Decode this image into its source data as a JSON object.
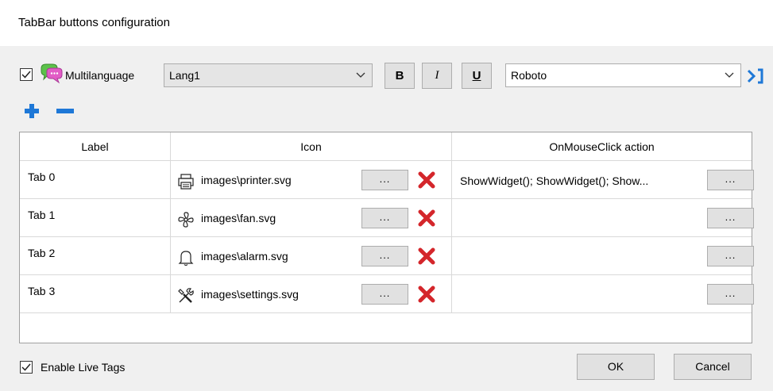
{
  "window": {
    "title": "TabBar buttons configuration"
  },
  "toolbar": {
    "multilanguage_label": "Multilanguage",
    "multilanguage_checked": true,
    "language": "Lang1",
    "bold_label": "B",
    "italic_label": "I",
    "underline_label": "U",
    "font": "Roboto"
  },
  "grid": {
    "columns": [
      "Label",
      "Icon",
      "OnMouseClick action"
    ],
    "rows": [
      {
        "label": "Tab 0",
        "icon": "printer-icon",
        "icon_path": "images\\printer.svg",
        "action": "ShowWidget(); ShowWidget(); Show..."
      },
      {
        "label": "Tab 1",
        "icon": "fan-icon",
        "icon_path": "images\\fan.svg",
        "action": ""
      },
      {
        "label": "Tab 2",
        "icon": "bell-icon",
        "icon_path": "images\\alarm.svg",
        "action": ""
      },
      {
        "label": "Tab 3",
        "icon": "settings-icon",
        "icon_path": "images\\settings.svg",
        "action": ""
      }
    ],
    "browse_label": "..."
  },
  "footer": {
    "enable_live_tags_label": "Enable Live Tags",
    "enable_live_tags_checked": true,
    "ok_label": "OK",
    "cancel_label": "Cancel"
  },
  "colors": {
    "accent_blue": "#1e78d7",
    "delete_red": "#d4262b"
  }
}
